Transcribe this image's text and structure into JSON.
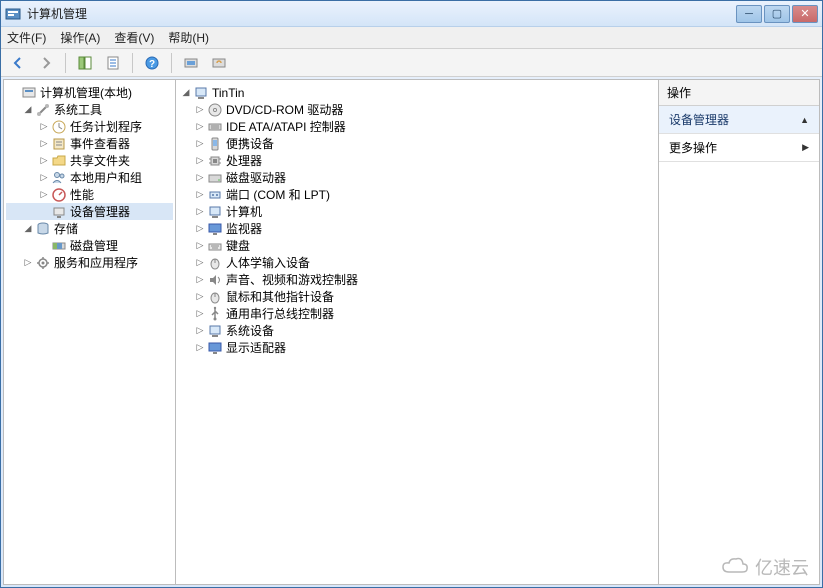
{
  "titlebar": {
    "title": "计算机管理"
  },
  "menu": {
    "file": "文件(F)",
    "action": "操作(A)",
    "view": "查看(V)",
    "help": "帮助(H)"
  },
  "left_tree": {
    "root": "计算机管理(本地)",
    "system_tools": "系统工具",
    "task_scheduler": "任务计划程序",
    "event_viewer": "事件查看器",
    "shared_folders": "共享文件夹",
    "local_users": "本地用户和组",
    "performance": "性能",
    "device_manager": "设备管理器",
    "storage": "存储",
    "disk_management": "磁盘管理",
    "services_apps": "服务和应用程序"
  },
  "mid_tree": {
    "root": "TinTin",
    "dvd": "DVD/CD-ROM 驱动器",
    "ide": "IDE ATA/ATAPI 控制器",
    "portable": "便携设备",
    "processors": "处理器",
    "disk_drives": "磁盘驱动器",
    "ports": "端口 (COM 和 LPT)",
    "computer": "计算机",
    "monitor": "监视器",
    "keyboard": "键盘",
    "hid": "人体学输入设备",
    "sound": "声音、视频和游戏控制器",
    "mouse": "鼠标和其他指针设备",
    "usb": "通用串行总线控制器",
    "system": "系统设备",
    "display": "显示适配器"
  },
  "right_pane": {
    "header": "操作",
    "section": "设备管理器",
    "more": "更多操作"
  },
  "watermark": "亿速云"
}
